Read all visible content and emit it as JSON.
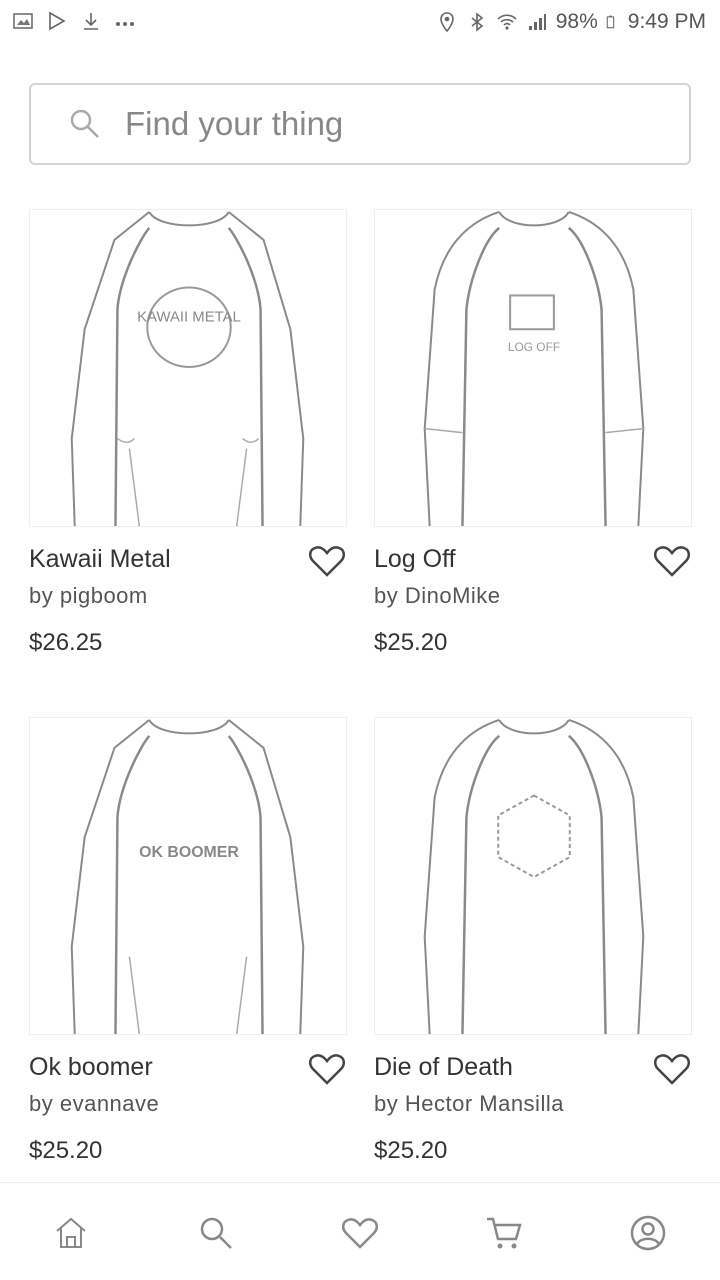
{
  "status_bar": {
    "left_icons": [
      "gallery-icon",
      "play-store-icon",
      "download-icon",
      "more-icon"
    ],
    "right_icons": [
      "location-icon",
      "bluetooth-icon",
      "wifi-icon",
      "signal-icon"
    ],
    "battery": "98%",
    "time": "9:49 PM"
  },
  "search": {
    "placeholder": "Find your thing",
    "icon": "search-icon"
  },
  "products": [
    {
      "title": "Kawaii Metal",
      "by": "by pigboom",
      "price": "$26.25",
      "design": "KAWAII METAL"
    },
    {
      "title": "Log Off",
      "by": "by DinoMike",
      "price": "$25.20",
      "design": "LOG OFF"
    },
    {
      "title": "Ok boomer",
      "by": "by evannave",
      "price": "$25.20",
      "design": "OK BOOMER"
    },
    {
      "title": "Die of Death",
      "by": "by Hector Mansilla",
      "price": "$25.20",
      "design": ""
    }
  ],
  "bottom_nav": {
    "items": [
      "home-icon",
      "search-icon",
      "heart-icon",
      "cart-icon",
      "profile-icon"
    ]
  }
}
